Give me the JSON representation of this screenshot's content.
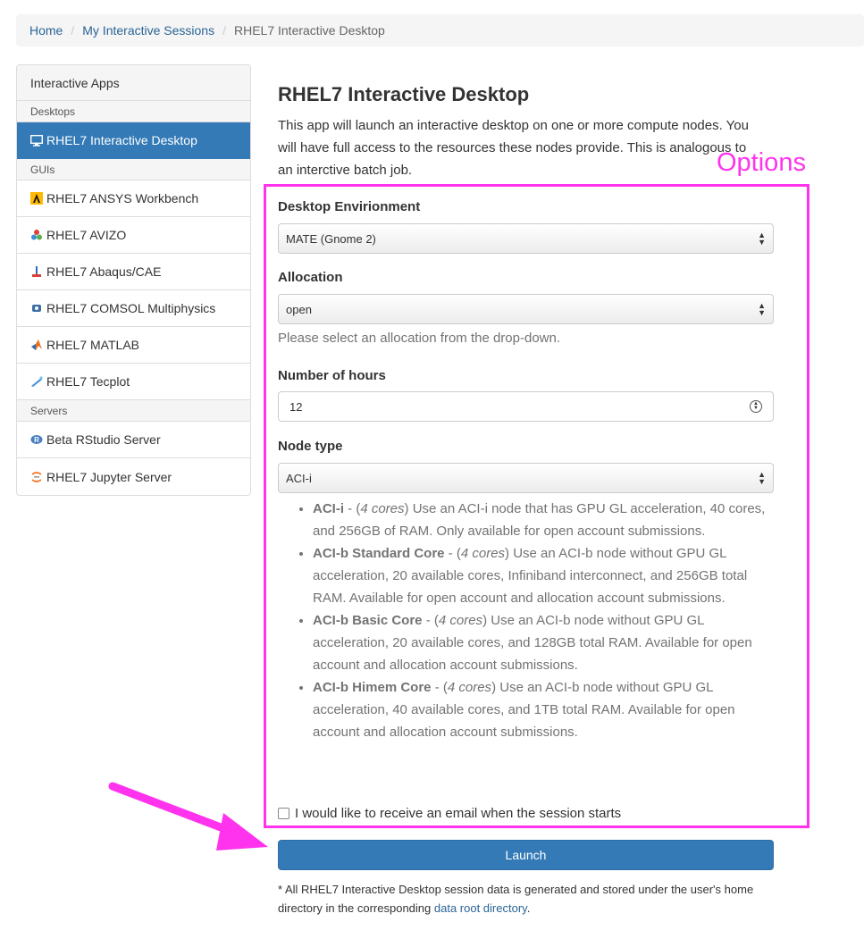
{
  "breadcrumb": {
    "home": "Home",
    "sessions": "My Interactive Sessions",
    "current": "RHEL7 Interactive Desktop"
  },
  "sidebar": {
    "heading": "Interactive Apps",
    "sections": {
      "desktops": "Desktops",
      "guis": "GUIs",
      "servers": "Servers"
    },
    "items": [
      {
        "label": "RHEL7 Interactive Desktop",
        "icon": "monitor-icon",
        "active": true
      },
      {
        "label": "RHEL7 ANSYS Workbench",
        "icon": "ansys-icon"
      },
      {
        "label": "RHEL7 AVIZO",
        "icon": "avizo-icon"
      },
      {
        "label": "RHEL7 Abaqus/CAE",
        "icon": "abaqus-icon"
      },
      {
        "label": "RHEL7 COMSOL Multiphysics",
        "icon": "comsol-icon"
      },
      {
        "label": "RHEL7 MATLAB",
        "icon": "matlab-icon"
      },
      {
        "label": "RHEL7 Tecplot",
        "icon": "tecplot-icon"
      },
      {
        "label": "Beta RStudio Server",
        "icon": "rstudio-icon"
      },
      {
        "label": "RHEL7 Jupyter Server",
        "icon": "jupyter-icon"
      }
    ]
  },
  "main": {
    "title": "RHEL7 Interactive Desktop",
    "intro": "This app will launch an interactive desktop on one or more compute nodes. You will have full access to the resources these nodes provide. This is analogous to an interctive batch job."
  },
  "annotation": {
    "options_label": "Options",
    "color": "#ff33ee"
  },
  "form": {
    "desktop_env": {
      "label": "Desktop Envirionment",
      "value": "MATE (Gnome 2)"
    },
    "allocation": {
      "label": "Allocation",
      "value": "open",
      "help": "Please select an allocation from the drop-down."
    },
    "hours": {
      "label": "Number of hours",
      "value": "12"
    },
    "node_type": {
      "label": "Node type",
      "value": "ACI-i"
    },
    "node_descriptions": [
      {
        "name": "ACI-i",
        "cores": "4 cores",
        "text": " Use an ACI-i node that has GPU GL acceleration, 40 cores, and 256GB of RAM. Only available for open account submissions."
      },
      {
        "name": "ACI-b Standard Core",
        "cores": "4 cores",
        "text": " Use an ACI-b node without GPU GL acceleration, 20 available cores, Infiniband interconnect, and 256GB total RAM. Available for open account and allocation account submissions."
      },
      {
        "name": "ACI-b Basic Core",
        "cores": "4 cores",
        "text": " Use an ACI-b node without GPU GL acceleration, 20 available cores, and 128GB total RAM. Available for open account and allocation account submissions."
      },
      {
        "name": "ACI-b Himem Core",
        "cores": "4 cores",
        "text": " Use an ACI-b node without GPU GL acceleration, 40 available cores, and 1TB total RAM. Available for open account and allocation account submissions."
      }
    ],
    "email_checkbox": {
      "label": "I would like to receive an email when the session starts",
      "checked": false
    },
    "launch_label": "Launch"
  },
  "footnote": {
    "text": "* All RHEL7 Interactive Desktop session data is generated and stored under the user's home directory in the corresponding ",
    "link": "data root directory",
    "end": "."
  },
  "colors": {
    "primary": "#337ab7",
    "link": "#2a6496",
    "annotation": "#ff33ee"
  }
}
